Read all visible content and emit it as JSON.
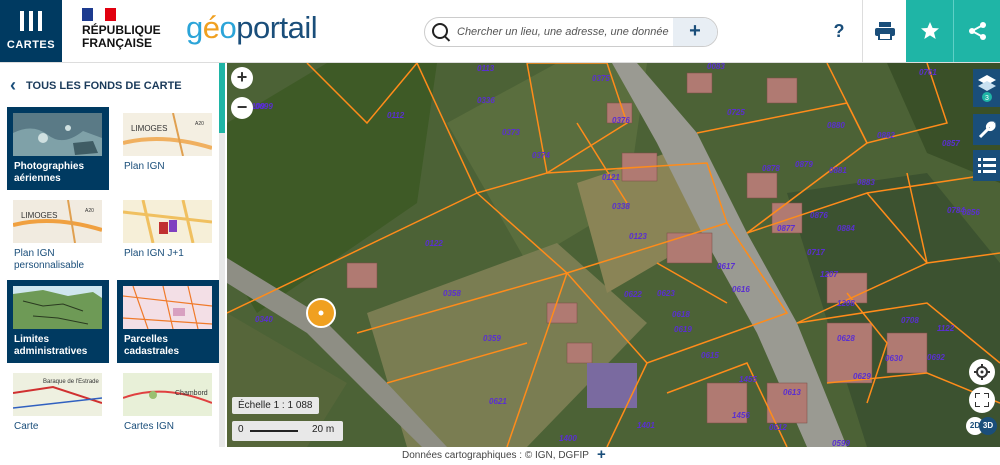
{
  "header": {
    "menu_label": "CARTES",
    "republic_line1": "RÉPUBLIQUE",
    "republic_line2": "FRANÇAISE",
    "logo_part1": "g",
    "logo_part2": "é",
    "logo_part3": "o",
    "logo_part4": "portail",
    "search_placeholder": "Chercher un lieu, une adresse, une donnée",
    "search_plus": "+",
    "help_label": "?",
    "print_icon": "printer-icon",
    "fav_icon": "star-icon",
    "share_icon": "share-icon"
  },
  "sidebar": {
    "title": "TOUS LES FONDS DE CARTE",
    "back_icon": "chevron-left-icon",
    "cards": [
      {
        "label": "Photographies aériennes",
        "selected": true
      },
      {
        "label": "Plan IGN",
        "selected": false
      },
      {
        "label": "Plan IGN personnalisable",
        "selected": false
      },
      {
        "label": "Plan IGN J+1",
        "selected": false
      },
      {
        "label": "Limites administratives",
        "selected": true
      },
      {
        "label": "Parcelles cadastrales",
        "selected": true
      },
      {
        "label": "Carte",
        "selected": false
      },
      {
        "label": "Cartes IGN",
        "selected": false
      }
    ],
    "thumb_labels": {
      "limoges1": "LIMOGES",
      "a20_1": "A20",
      "limoges2": "LIMOGES",
      "a20_2": "A20",
      "baraque": "Baraque de l'Estrade",
      "chambord": "Chambord"
    }
  },
  "map": {
    "zoom_in": "+",
    "zoom_out": "−",
    "scale_label": "Échelle 1 : 1 088",
    "scale_start": "0",
    "scale_end": "20 m",
    "layers_count": "3",
    "view_2d": "2D",
    "view_3d": "3D",
    "parcels": [
      "0113",
      "0375",
      "0083",
      "0761",
      "0112",
      "0336",
      "0725",
      "0880",
      "0882",
      "0857",
      "0373",
      "0374",
      "0376",
      "0121",
      "0878",
      "0879",
      "0881",
      "0883",
      "0338",
      "0876",
      "0877",
      "0884",
      "0784",
      "0856",
      "0123",
      "0717",
      "0617",
      "1207",
      "0122",
      "0616",
      "0358",
      "0622",
      "0623",
      "0618",
      "1208",
      "0340",
      "0359",
      "0619",
      "0708",
      "1122",
      "0615",
      "0628",
      "0630",
      "0692",
      "0629",
      "1455",
      "0613",
      "0621",
      "1456",
      "1401",
      "0612",
      "1400",
      "0599",
      "0109",
      "0099"
    ]
  },
  "footer": {
    "attribution": "Données cartographiques : ©   IGN,  DGFIP",
    "plus": "+"
  },
  "colors": {
    "navy": "#003a61",
    "teal": "#1fb5a6",
    "parcel_line": "#ff8c1a",
    "parcel_label": "#5a2fd0"
  }
}
